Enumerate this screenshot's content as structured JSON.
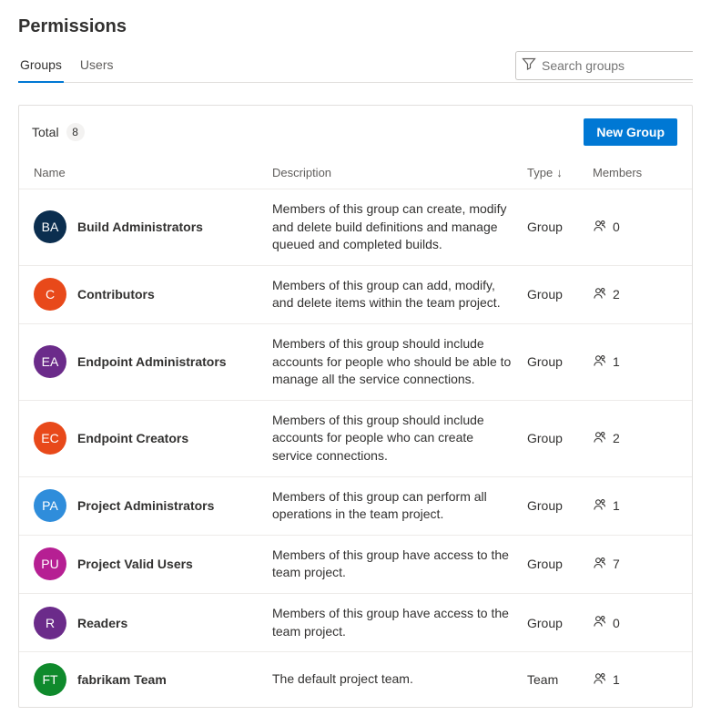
{
  "title": "Permissions",
  "tabs": [
    {
      "label": "Groups",
      "active": true
    },
    {
      "label": "Users",
      "active": false
    }
  ],
  "search": {
    "placeholder": "Search groups"
  },
  "total_label": "Total",
  "total_count": "8",
  "new_group_label": "New Group",
  "columns": {
    "name": "Name",
    "description": "Description",
    "type": "Type",
    "members": "Members"
  },
  "rows": [
    {
      "initials": "BA",
      "color": "#0b2e4f",
      "name": "Build Administrators",
      "description": "Members of this group can create, modify and delete build definitions and manage queued and completed builds.",
      "type": "Group",
      "members": "0"
    },
    {
      "initials": "C",
      "color": "#e8491a",
      "name": "Contributors",
      "description": "Members of this group can add, modify, and delete items within the team project.",
      "type": "Group",
      "members": "2"
    },
    {
      "initials": "EA",
      "color": "#6b2b8a",
      "name": "Endpoint Administrators",
      "description": "Members of this group should include accounts for people who should be able to manage all the service connections.",
      "type": "Group",
      "members": "1"
    },
    {
      "initials": "EC",
      "color": "#e8491a",
      "name": "Endpoint Creators",
      "description": "Members of this group should include accounts for people who can create service connections.",
      "type": "Group",
      "members": "2"
    },
    {
      "initials": "PA",
      "color": "#2f8ddb",
      "name": "Project Administrators",
      "description": "Members of this group can perform all operations in the team project.",
      "type": "Group",
      "members": "1"
    },
    {
      "initials": "PU",
      "color": "#b61f93",
      "name": "Project Valid Users",
      "description": "Members of this group have access to the team project.",
      "type": "Group",
      "members": "7"
    },
    {
      "initials": "R",
      "color": "#6b2b8a",
      "name": "Readers",
      "description": "Members of this group have access to the team project.",
      "type": "Group",
      "members": "0"
    },
    {
      "initials": "FT",
      "color": "#0f8a2c",
      "name": "fabrikam Team",
      "description": "The default project team.",
      "type": "Team",
      "members": "1"
    }
  ]
}
